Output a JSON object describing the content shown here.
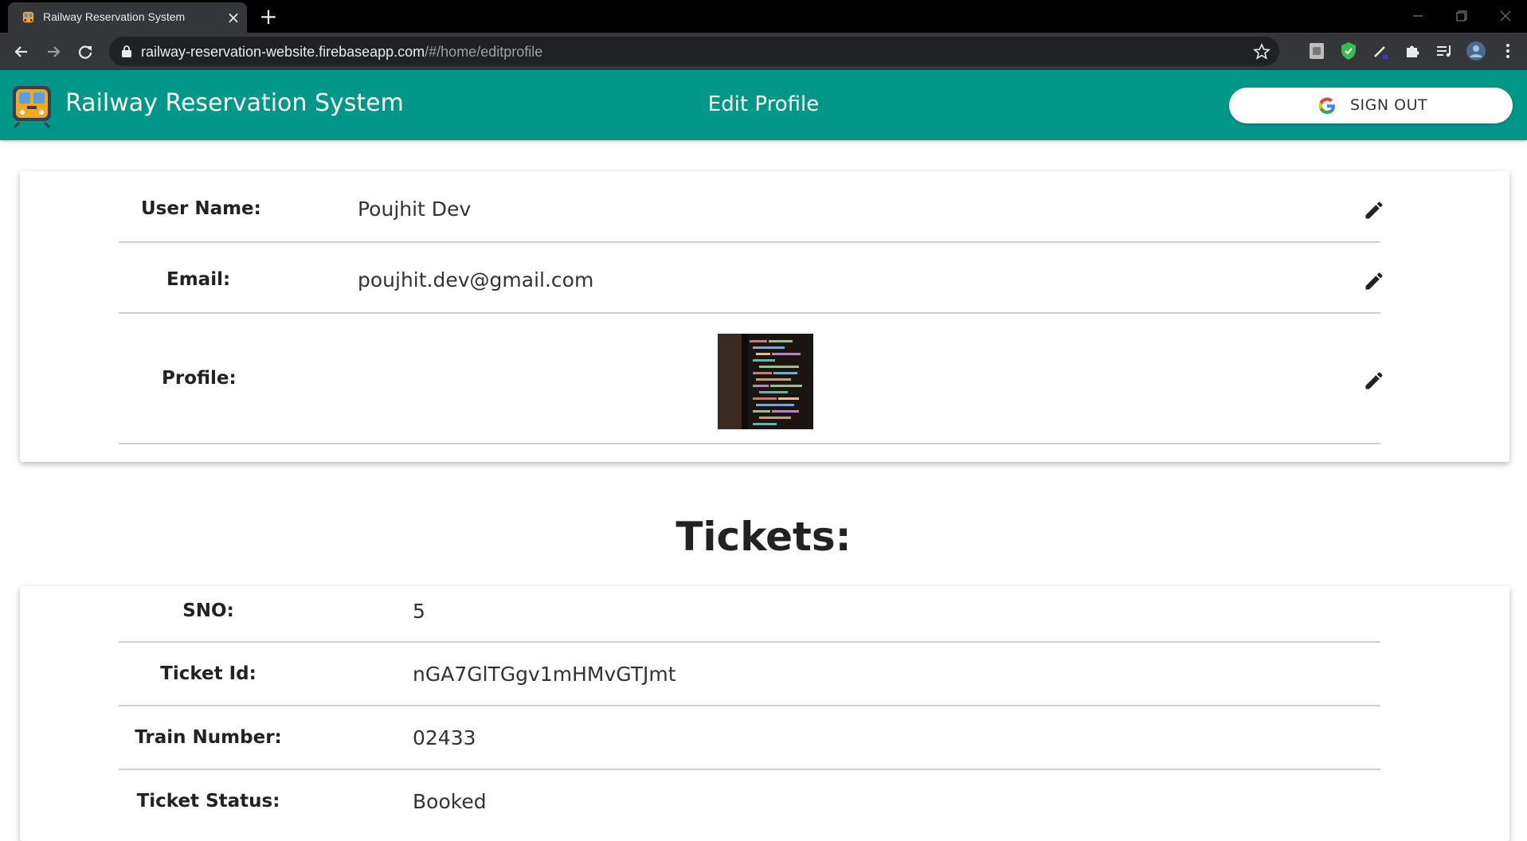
{
  "browser": {
    "tab_title": "Railway Reservation System",
    "url_host": "railway-reservation-website.firebaseapp.com",
    "url_path": "/#/home/editprofile"
  },
  "appbar": {
    "title": "Railway Reservation System",
    "page_title": "Edit Profile",
    "signout_label": "SIGN OUT"
  },
  "profile": {
    "username_label": "User Name:",
    "username_value": "Poujhit Dev",
    "email_label": "Email:",
    "email_value": "poujhit.dev@gmail.com",
    "profile_label": "Profile:"
  },
  "tickets": {
    "heading": "Tickets:",
    "rows": [
      {
        "label": "SNO:",
        "value": "5"
      },
      {
        "label": "Ticket Id:",
        "value": "nGA7GlTGgv1mHMvGTJmt"
      },
      {
        "label": "Train Number:",
        "value": "02433"
      },
      {
        "label": "Ticket Status:",
        "value": "Booked"
      }
    ]
  },
  "colors": {
    "appbar": "#009688",
    "chrome_dark": "#35363a",
    "tabstrip": "#000000"
  },
  "icons": [
    "train-logo-icon",
    "google-icon",
    "edit-pencil-icon",
    "lock-icon",
    "star-icon",
    "back-icon",
    "forward-icon",
    "reload-icon",
    "close-icon",
    "plus-icon"
  ]
}
